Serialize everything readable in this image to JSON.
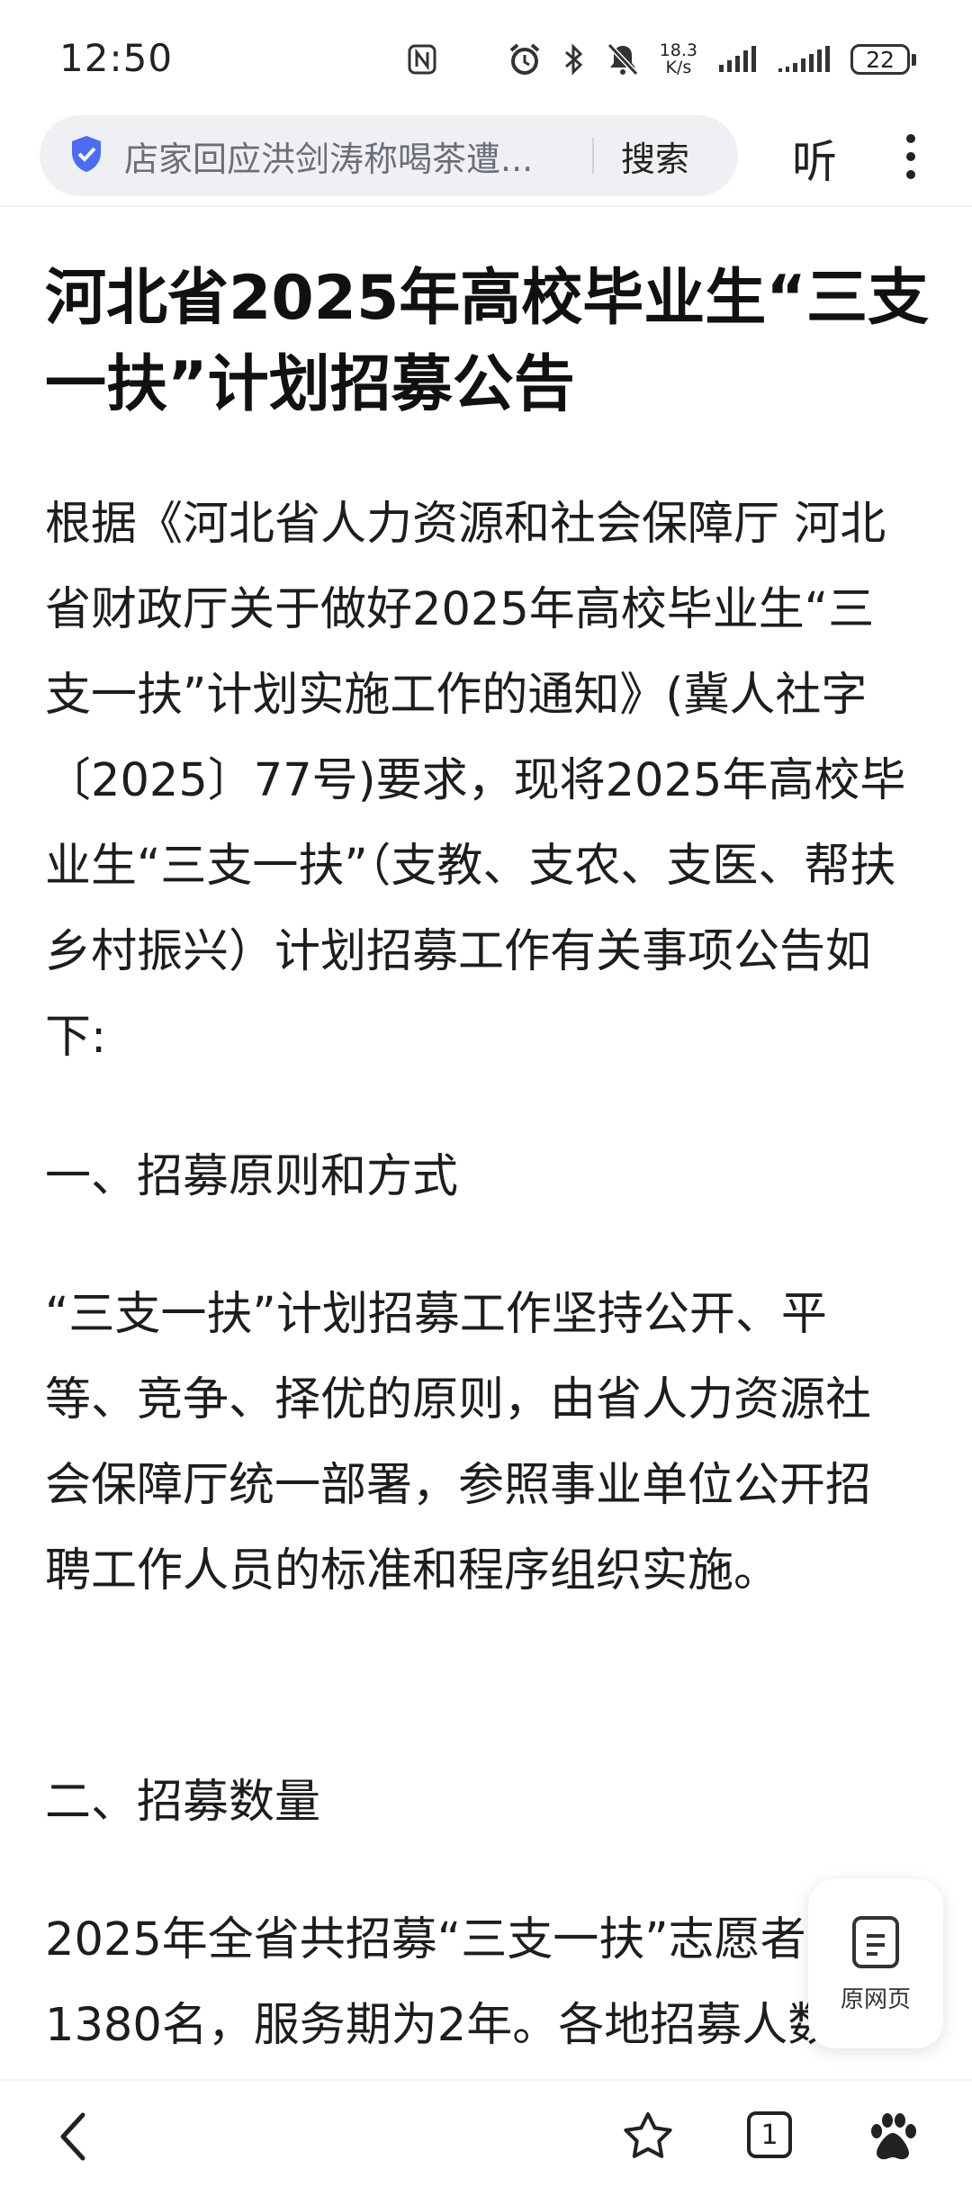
{
  "status_bar": {
    "time": "12:50",
    "net_speed_value": "18.3",
    "net_speed_unit": "K/s",
    "battery": "22",
    "icons": [
      "nfc-icon",
      "alarm-icon",
      "bluetooth-icon",
      "mute-icon",
      "signal-icon",
      "signal-icon",
      "battery-icon"
    ]
  },
  "search_bar": {
    "query": "店家回应洪剑涛称喝茶遭...",
    "search_label": "搜索",
    "listen_label": "听"
  },
  "article": {
    "title": "河北省2025年高校毕业生“三支一扶”计划招募公告",
    "paragraph_1": "根据《河北省人力资源和社会保障厅 河北省财政厅关于做好2025年高校毕业生“三支一扶”计划实施工作的通知》(冀人社字〔2025〕77号)要求，现将2025年高校毕业生“三支一扶”（支教、支农、支医、帮扶乡村振兴）计划招募工作有关事项公告如下:",
    "heading_1": "一、招募原则和方式",
    "paragraph_2": "“三支一扶”计划招募工作坚持公开、平等、竞争、择优的原则，由省人力资源社会保障厅统一部署，参照事业单位公开招聘工作人员的标准和程序组织实施。",
    "heading_2": "二、招募数量",
    "paragraph_3": "2025年全省共招募“三支一扶”志愿者1380名，服务期为2年。各地招募人数..."
  },
  "float_button": {
    "label": "原网页"
  },
  "bottom_nav": {
    "tab_count": "1"
  }
}
